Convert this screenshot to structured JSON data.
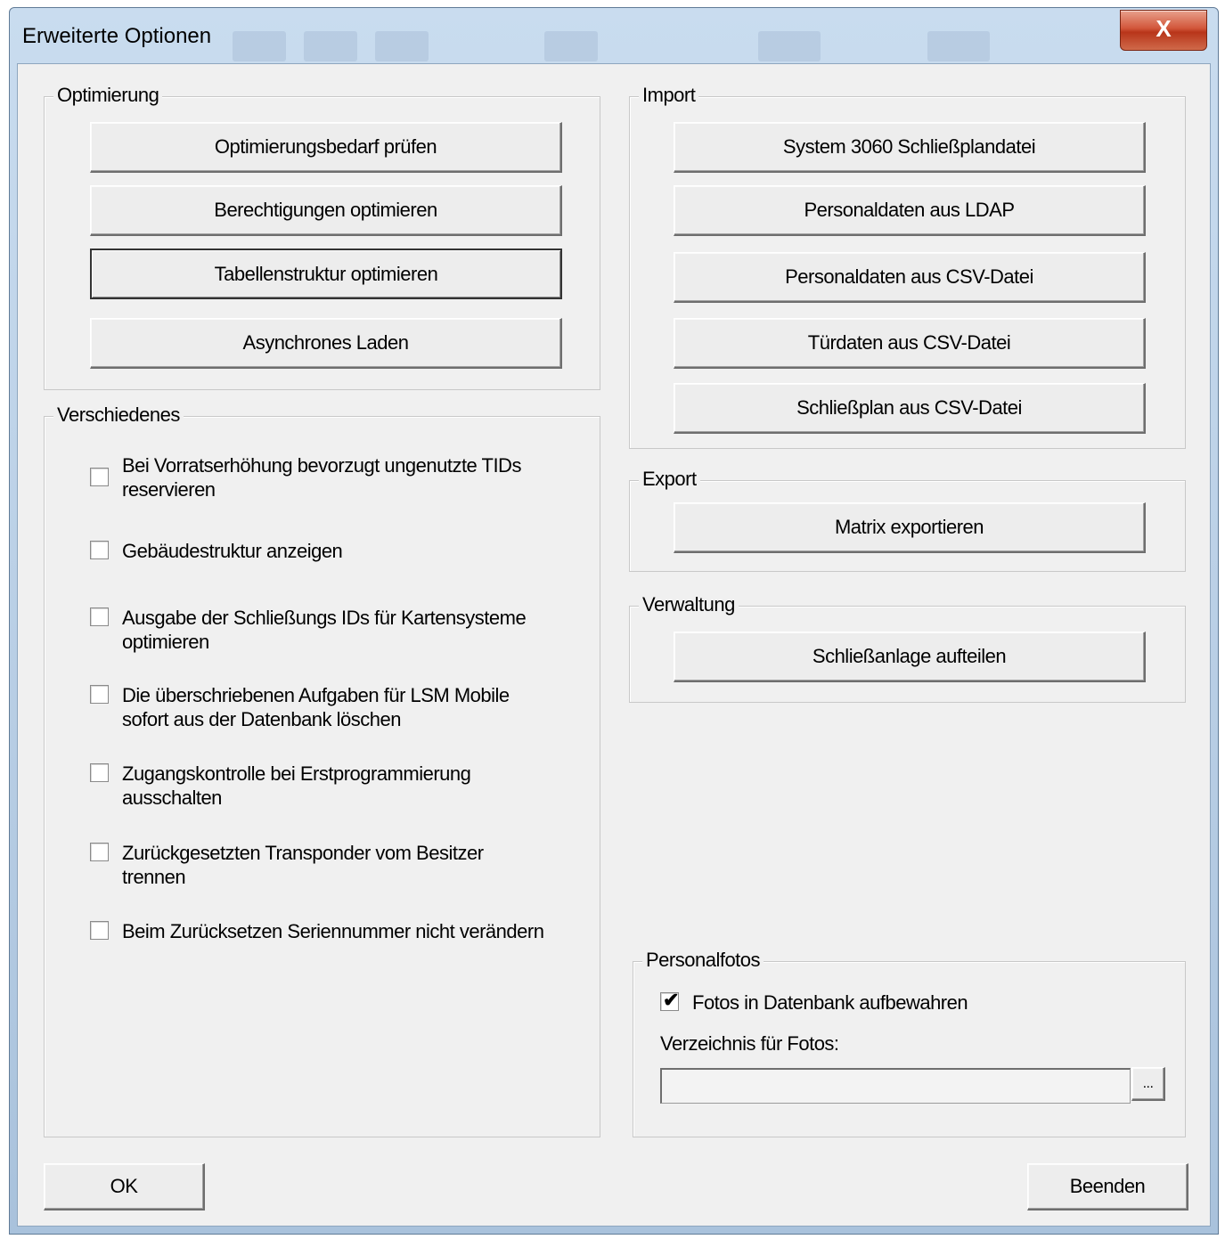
{
  "window": {
    "title": "Erweiterte Optionen",
    "close_glyph": "X"
  },
  "optimierung": {
    "title": "Optimierung",
    "buttons": [
      "Optimierungsbedarf prüfen",
      "Berechtigungen optimieren",
      "Tabellenstruktur optimieren",
      "Asynchrones Laden"
    ]
  },
  "verschiedenes": {
    "title": "Verschiedenes",
    "options": [
      {
        "label": "Bei Vorratserhöhung bevorzugt ungenutzte TIDs\nreservieren",
        "checked": false
      },
      {
        "label": "Gebäudestruktur anzeigen",
        "checked": false
      },
      {
        "label": "Ausgabe der Schließungs IDs für Kartensysteme\noptimieren",
        "checked": false
      },
      {
        "label": "Die überschriebenen Aufgaben für LSM Mobile\nsofort aus der Datenbank löschen",
        "checked": false
      },
      {
        "label": "Zugangskontrolle bei Erstprogrammierung\nausschalten",
        "checked": false
      },
      {
        "label": "Zurückgesetzten Transponder vom Besitzer\ntrennen",
        "checked": false
      },
      {
        "label": "Beim Zurücksetzen Seriennummer nicht verändern",
        "checked": false
      }
    ]
  },
  "import": {
    "title": "Import",
    "buttons": [
      "System 3060 Schließplandatei",
      "Personaldaten aus LDAP",
      "Personaldaten aus CSV-Datei",
      "Türdaten aus CSV-Datei",
      "Schließplan aus CSV-Datei"
    ]
  },
  "export": {
    "title": "Export",
    "button": "Matrix exportieren"
  },
  "verwaltung": {
    "title": "Verwaltung",
    "button": "Schließanlage aufteilen"
  },
  "personalfotos": {
    "title": "Personalfotos",
    "checkbox_label": "Fotos in Datenbank aufbewahren",
    "checkbox_checked": true,
    "checkmark_glyph": "✔",
    "directory_label": "Verzeichnis für Fotos:",
    "directory_value": "",
    "browse_label": "..."
  },
  "footer": {
    "ok_label": "OK",
    "close_label": "Beenden"
  }
}
